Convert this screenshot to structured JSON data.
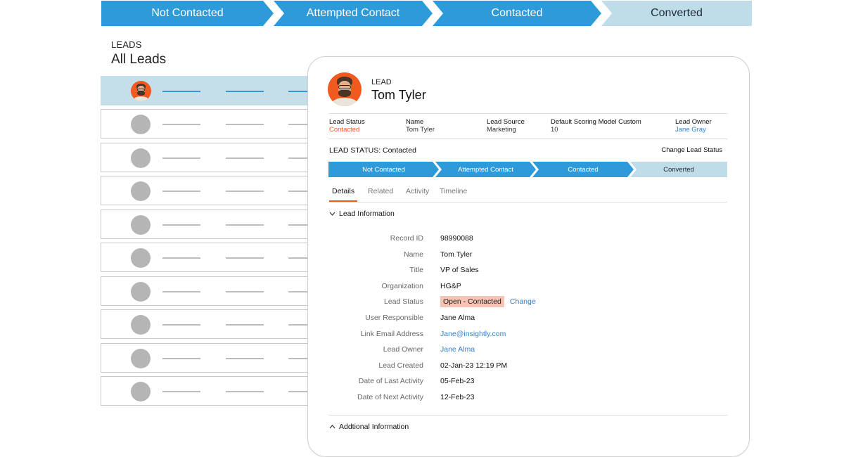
{
  "stage_path": {
    "steps": [
      "Not Contacted",
      "Attempted Contact",
      "Contacted",
      "Converted"
    ],
    "active_color": "#2f9ad9",
    "pending_color": "#bfdde9"
  },
  "leads": {
    "section_label": "LEADS",
    "view_title": "All Leads",
    "rows": 10,
    "selected_row": 0
  },
  "lead": {
    "kind_label": "LEAD",
    "name": "Tom Tyler",
    "summary": [
      {
        "key": "Lead Status",
        "value": "Contacted"
      },
      {
        "key": "Name",
        "value": "Tom Tyler"
      },
      {
        "key": "Lead Source",
        "value": "Marketing"
      },
      {
        "key": "Default Scoring Model Custom",
        "value": "10"
      },
      {
        "key": "Lead Owner",
        "value": "Jane Gray"
      }
    ],
    "status_heading": "LEAD STATUS: Contacted",
    "change_status_label": "Change Lead Status",
    "path_steps": [
      "Not Contacted",
      "Attempted Contact",
      "Contacted",
      "Converted"
    ],
    "tabs": [
      "Details",
      "Related",
      "Activity",
      "Timeline"
    ],
    "active_tab": "Details",
    "lead_info_title": "Lead Information",
    "fields": [
      {
        "label": "Record ID",
        "value": "98990088"
      },
      {
        "label": "Name",
        "value": "Tom Tyler"
      },
      {
        "label": "Title",
        "value": "VP of Sales"
      },
      {
        "label": "Organization",
        "value": "HG&P"
      },
      {
        "label": "Lead Status",
        "value": "Open - Contacted",
        "action": "Change"
      },
      {
        "label": "User Responsible",
        "value": "Jane Alma"
      },
      {
        "label": "Link Email Address",
        "value": "Jane@insightly.com"
      },
      {
        "label": "Lead Owner",
        "value": "Jane Alma"
      },
      {
        "label": "Lead Created",
        "value": "02-Jan-23 12:19 PM"
      },
      {
        "label": "Date of Last Activity",
        "value": "05-Feb-23"
      },
      {
        "label": "Date of Next Activity",
        "value": "12-Feb-23"
      }
    ],
    "additional_info_title": "Addtional Information",
    "accent_color": "#f05a1e",
    "link_color": "#2f7fd0"
  }
}
